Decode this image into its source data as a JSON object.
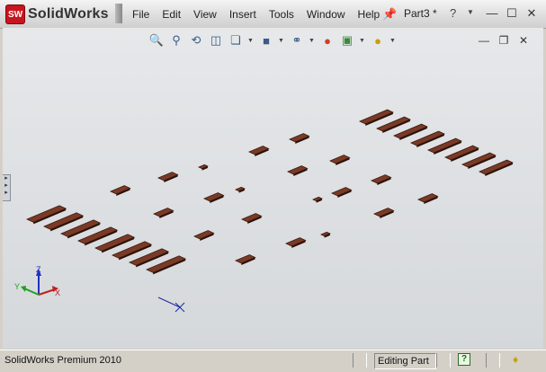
{
  "app": {
    "logo_badge": "SW",
    "logo_text": "SolidWorks",
    "document_name": "Part3 *",
    "brand_color": "#c8141e"
  },
  "menu": {
    "items": [
      "File",
      "Edit",
      "View",
      "Insert",
      "Tools",
      "Window",
      "Help"
    ]
  },
  "titlebar_icons": {
    "pin": "pushpin-icon",
    "help": "help-question-icon",
    "help_dropdown": "chevron-down-icon",
    "minimize": "minimize-icon",
    "maximize": "maximize-icon",
    "close": "close-icon"
  },
  "view_toolbar": {
    "icons": [
      "zoom-to-fit-icon",
      "zoom-to-area-icon",
      "previous-view-icon",
      "section-view-icon",
      "view-orientation-icon",
      "display-style-icon",
      "hide-show-items-icon",
      "edit-appearance-icon",
      "apply-scene-icon",
      "view-settings-icon"
    ]
  },
  "viewport": {
    "part_color": "#7a3a26",
    "triad_labels": {
      "x": "X",
      "y": "Y",
      "z": "Z"
    }
  },
  "status": {
    "left_text": "SolidWorks Premium 2010",
    "mode_text": "Editing Part",
    "help_icon_glyph": "?",
    "tag_icon": "tag-icon"
  }
}
